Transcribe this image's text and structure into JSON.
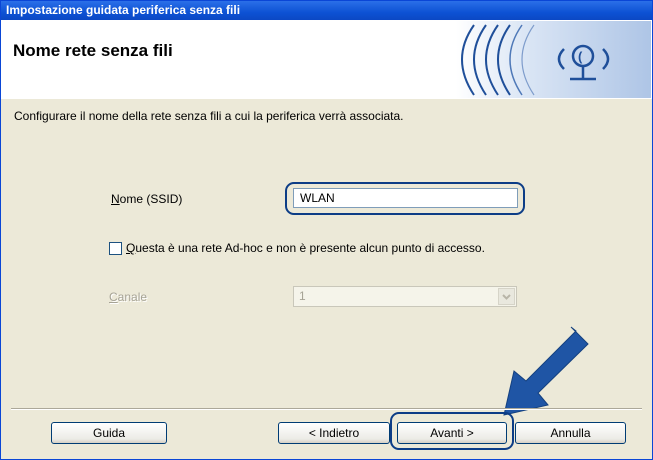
{
  "window": {
    "title": "Impostazione guidata periferica senza fili"
  },
  "header": {
    "title": "Nome rete senza fili",
    "logo_icon": "wireless-network-icon"
  },
  "description": "Configurare il nome della rete senza fili a cui la periferica verrà associata.",
  "ssid": {
    "label": "Nome (SSID)",
    "value": "WLAN"
  },
  "adhoc": {
    "label": "Questa è una rete Ad-hoc e non è presente alcun punto di accesso.",
    "checked": false
  },
  "channel": {
    "label": "Canale",
    "value": "1",
    "enabled": false
  },
  "buttons": {
    "help": "Guida",
    "back": "< Indietro",
    "next": "Avanti >",
    "cancel": "Annulla"
  },
  "colors": {
    "title_bar": "#0d52d4",
    "highlight_ring": "#0d3d86",
    "arrow": "#1f55a5"
  }
}
